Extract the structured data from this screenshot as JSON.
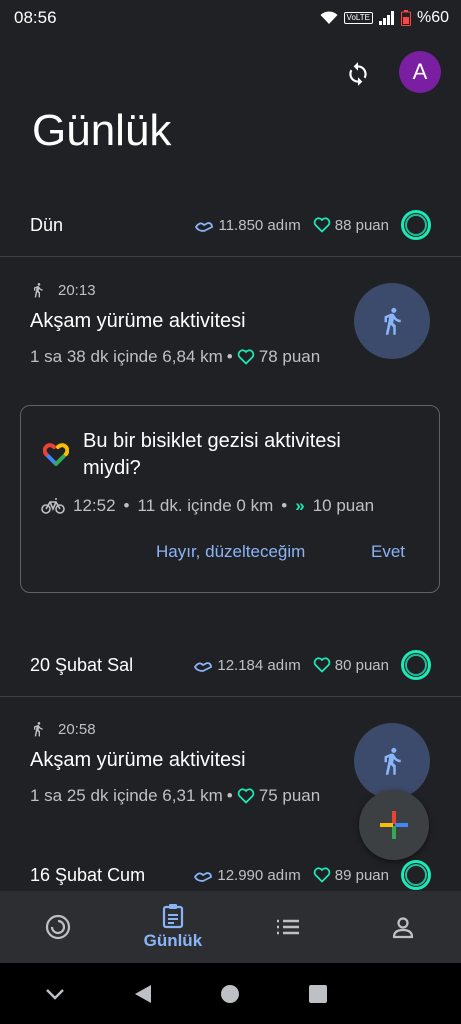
{
  "status_bar": {
    "time": "08:56",
    "volte": "VoLTE",
    "battery": "%60"
  },
  "header": {
    "avatar_letter": "A",
    "title": "Günlük"
  },
  "days": [
    {
      "label": "Dün",
      "steps": "11.850 adım",
      "points": "88 puan"
    },
    {
      "label": "20 Şubat Sal",
      "steps": "12.184 adım",
      "points": "80 puan"
    },
    {
      "label": "16 Şubat Cum",
      "steps": "12.990 adım",
      "points": "89 puan"
    }
  ],
  "activities": [
    {
      "time": "20:13",
      "title": "Akşam yürüme aktivitesi",
      "details": "1 sa 38 dk içinde 6,84 km",
      "points": "78 puan"
    },
    {
      "time": "20:58",
      "title": "Akşam yürüme aktivitesi",
      "details": "1 sa 25 dk içinde 6,31 km",
      "points": "75 puan"
    }
  ],
  "prompt_card": {
    "question": "Bu bir bisiklet gezisi aktivitesi miydi?",
    "time": "12:52",
    "duration": "11 dk. içinde 0 km",
    "points": "10 puan",
    "decline_label": "Hayır, düzelteceğim",
    "confirm_label": "Evet"
  },
  "bottom_nav": {
    "journal_label": "Günlük"
  },
  "colors": {
    "accent": "#8ab4f8",
    "ring": "#1de9b6",
    "heart": "#1de9b6",
    "avatar": "#7b1fa2"
  }
}
